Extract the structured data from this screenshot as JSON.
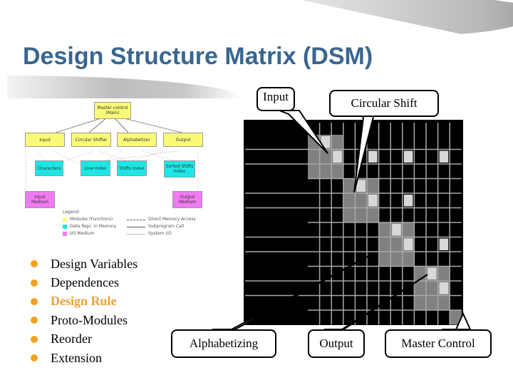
{
  "slide": {
    "title": "Design Structure Matrix (DSM)"
  },
  "module_diagram": {
    "boxes": {
      "master": "Master control (Main)",
      "input": "Input",
      "circular_shifter": "Circular Shifter",
      "alphabetizer": "Alphabetizer",
      "output": "Output",
      "characters": "Characters",
      "line_index": "Line Index",
      "shifts_index": "Shifts Index",
      "sorted_shifts_index": "Sorted Shifts Index",
      "input_medium": "Input Medium",
      "output_medium": "Output Medium"
    },
    "legend": {
      "title": "Legend:",
      "modules": "Modules (Functions)",
      "data_rep": "Data Repr. in Memory",
      "io_medium": "I/O Medium",
      "direct_memory_access": "Direct Memory Access",
      "subprogram_call": "Subprogram Call",
      "system_io": "System I/O"
    },
    "colors": {
      "module": "#fafa78",
      "data": "#1ee6e6",
      "io": "#f07af0"
    }
  },
  "bullets": [
    {
      "label": "Design Variables",
      "highlight": false
    },
    {
      "label": "Dependences",
      "highlight": false
    },
    {
      "label": "Design Rule",
      "highlight": true
    },
    {
      "label": "Proto-Modules",
      "highlight": false
    },
    {
      "label": "Reorder",
      "highlight": false
    },
    {
      "label": "Extension",
      "highlight": false
    }
  ],
  "callouts": {
    "input": "Input",
    "circular_shift": "Circular Shift",
    "alphabetizing": "Alphabetizing",
    "output": "Output",
    "master_control": "Master Control"
  },
  "dsm": {
    "size": 13,
    "modules": [
      {
        "name": "Input",
        "rows": [
          0,
          2
        ]
      },
      {
        "name": "Circular Shift",
        "rows": [
          3,
          5
        ]
      },
      {
        "name": "Alphabetizing",
        "rows": [
          6,
          8
        ]
      },
      {
        "name": "Output",
        "rows": [
          9,
          11
        ]
      },
      {
        "name": "Master Control",
        "rows": [
          12,
          12
        ]
      }
    ],
    "dependencies": [
      [
        0,
        1
      ],
      [
        1,
        2
      ],
      [
        1,
        5
      ],
      [
        1,
        8
      ],
      [
        1,
        11
      ],
      [
        3,
        4
      ],
      [
        4,
        5
      ],
      [
        4,
        8
      ],
      [
        6,
        7
      ],
      [
        7,
        8
      ],
      [
        7,
        11
      ],
      [
        9,
        10
      ],
      [
        10,
        11
      ]
    ],
    "colors": {
      "background": "#000000",
      "grid": "#a8a8a8",
      "block": "#808080",
      "mark": "#d8d8d8"
    }
  }
}
